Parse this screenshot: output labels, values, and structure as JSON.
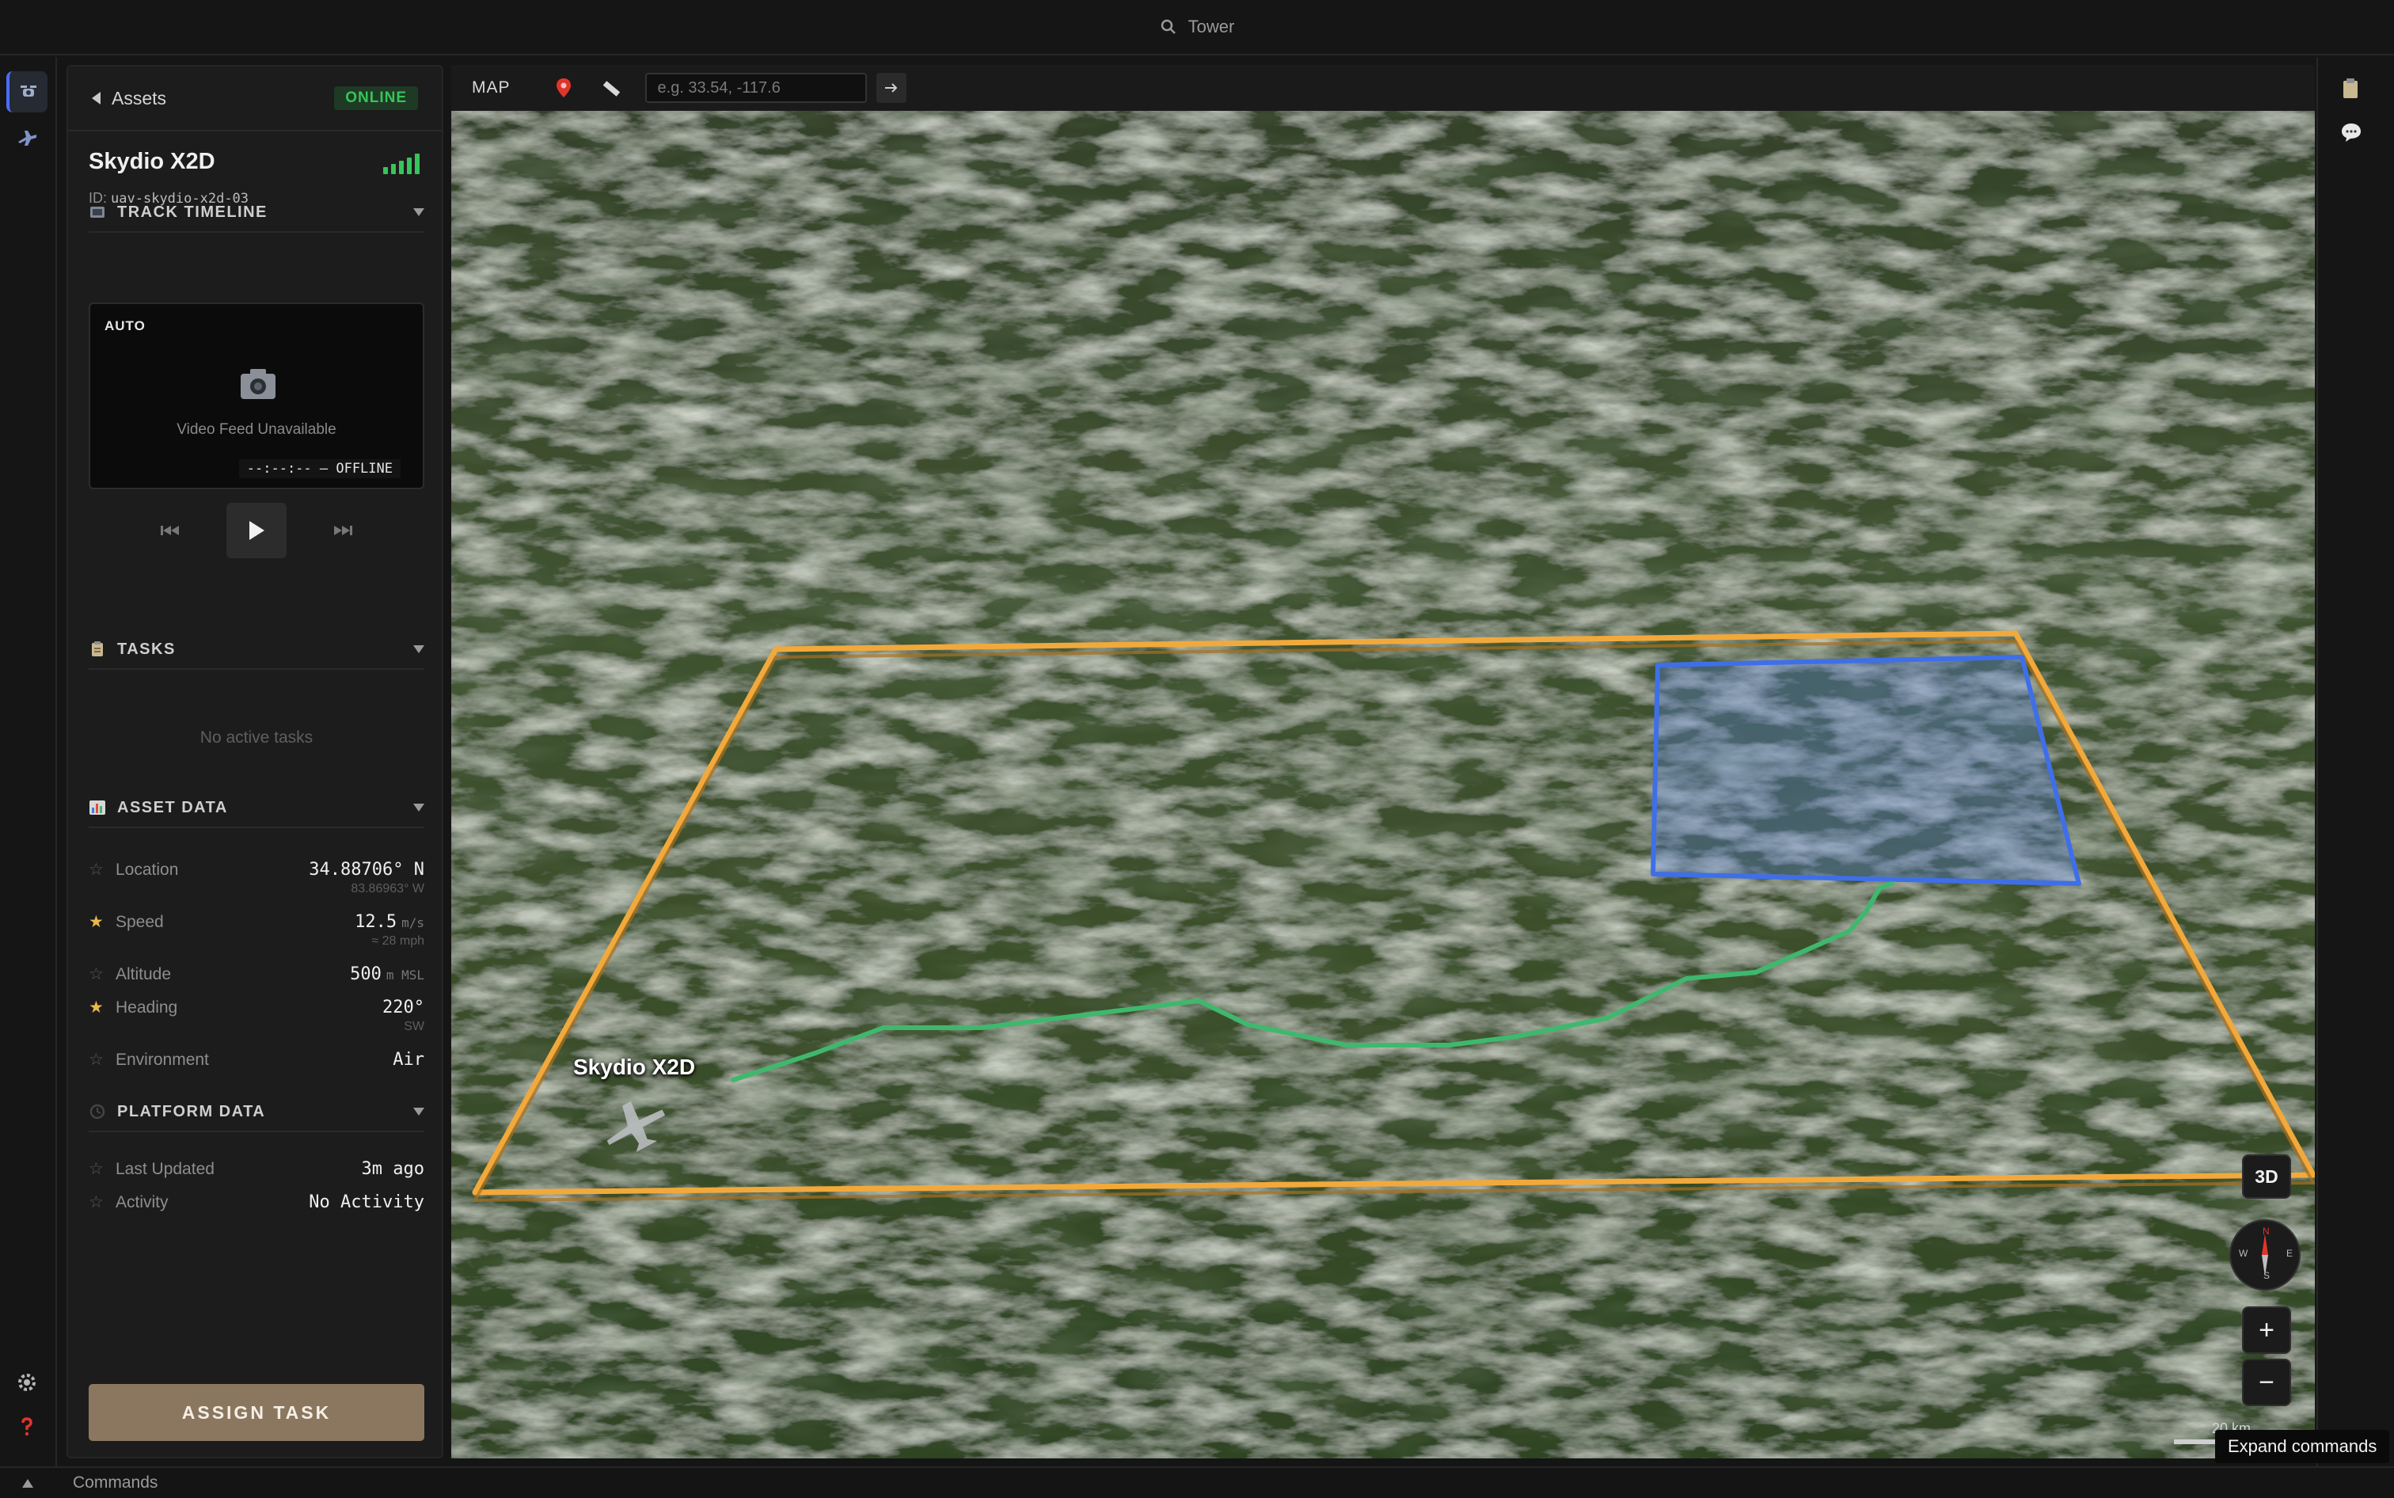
{
  "app": {
    "title": "Tower"
  },
  "sidebar": {
    "back_label": "Assets",
    "status": "ONLINE",
    "asset_name": "Skydio X2D",
    "asset_id_prefix": "ID:",
    "asset_id": "uav-skydio-x2d-03",
    "sections": {
      "track_timeline": "TRACK TIMELINE",
      "tasks": "TASKS",
      "asset_data": "ASSET DATA",
      "platform_data": "PLATFORM DATA"
    },
    "video": {
      "mode": "AUTO",
      "message": "Video Feed Unavailable",
      "status": "--:--:-- – OFFLINE"
    },
    "tasks_empty": "No active tasks",
    "asset_data": {
      "location": {
        "label": "Location",
        "value": "34.88706° N",
        "sub": "83.86963° W"
      },
      "speed": {
        "label": "Speed",
        "value": "12.5",
        "unit": "m/s",
        "sub": "≈ 28 mph"
      },
      "altitude": {
        "label": "Altitude",
        "value": "500",
        "unit": "m MSL"
      },
      "heading": {
        "label": "Heading",
        "value": "220°",
        "sub": "SW"
      },
      "environment": {
        "label": "Environment",
        "value": "Air"
      }
    },
    "platform_data": {
      "last_updated": {
        "label": "Last Updated",
        "value": "3m ago"
      },
      "activity": {
        "label": "Activity",
        "value": "No Activity"
      }
    },
    "assign_button": "ASSIGN TASK"
  },
  "map": {
    "label": "MAP",
    "coord_placeholder": "e.g. 33.54, -117.6",
    "asset_label": "Skydio X2D",
    "view_mode": "3D",
    "compass": {
      "n": "N",
      "s": "S",
      "e": "E",
      "w": "W"
    },
    "zoom_in": "+",
    "zoom_out": "−",
    "scale": "20 km",
    "colors": {
      "boundary": "#f2a93b",
      "zone": "#3f6fe8",
      "track": "#3fb86e"
    }
  },
  "bottom": {
    "commands_label": "Commands",
    "tooltip": "Expand commands"
  }
}
